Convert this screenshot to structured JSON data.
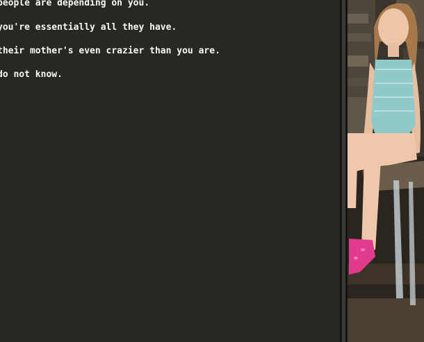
{
  "editor": {
    "lines": [
      "people are depending on you.",
      "you're essentially all they have.",
      "their mother's even crazier than you are.",
      "do not know."
    ]
  },
  "colors": {
    "editor_background": "#272822",
    "editor_text": "#f8f8f2",
    "splitter": "#141413",
    "photo_rock": "#2f2a24",
    "swimsuit": "#8fc9c9",
    "clogs": "#e23a8c"
  },
  "photo": {
    "subject": "photo-of-girl-sitting-by-waterfall"
  }
}
